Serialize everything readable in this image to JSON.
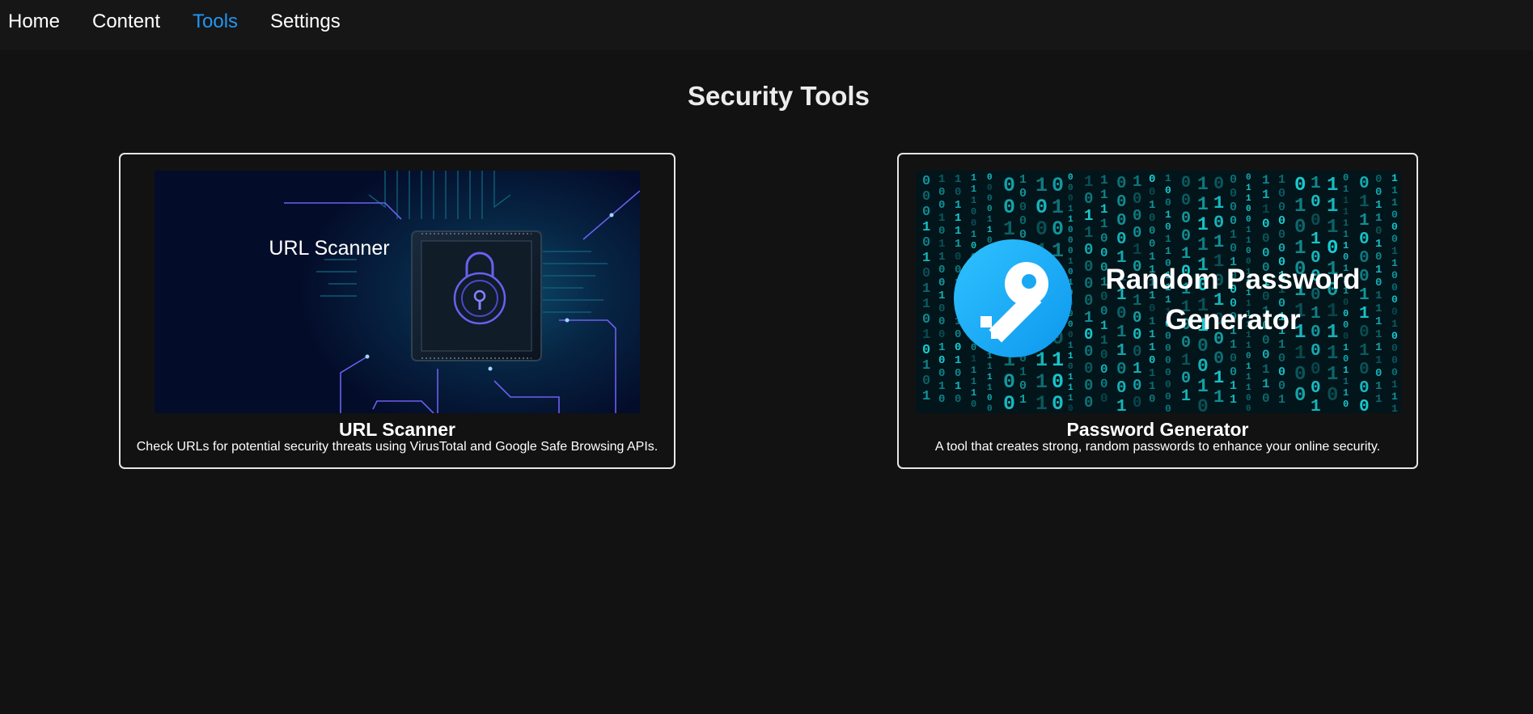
{
  "nav": {
    "items": [
      {
        "label": "Home",
        "active": false
      },
      {
        "label": "Content",
        "active": false
      },
      {
        "label": "Tools",
        "active": true
      },
      {
        "label": "Settings",
        "active": false
      }
    ],
    "active_color": "#2196f3"
  },
  "page": {
    "title": "Security Tools"
  },
  "tools": [
    {
      "title": "URL Scanner",
      "description": "Check URLs for potential security threats using VirusTotal and Google Safe Browsing APIs.",
      "image_text": "URL Scanner",
      "image_icon": "padlock-chip-icon"
    },
    {
      "title": "Password Generator",
      "description": "A tool that creates strong, random passwords to enhance your online security.",
      "image_text_line1": "Random Password",
      "image_text_line2": "Generator",
      "image_icon": "key-icon"
    }
  ],
  "colors": {
    "background": "#121212",
    "nav_background": "#161616",
    "card_border": "#e6e6e6",
    "scanner_image_bg": "#031030",
    "generator_image_bg": "#02151a",
    "key_circle": "#1ab2f5"
  }
}
